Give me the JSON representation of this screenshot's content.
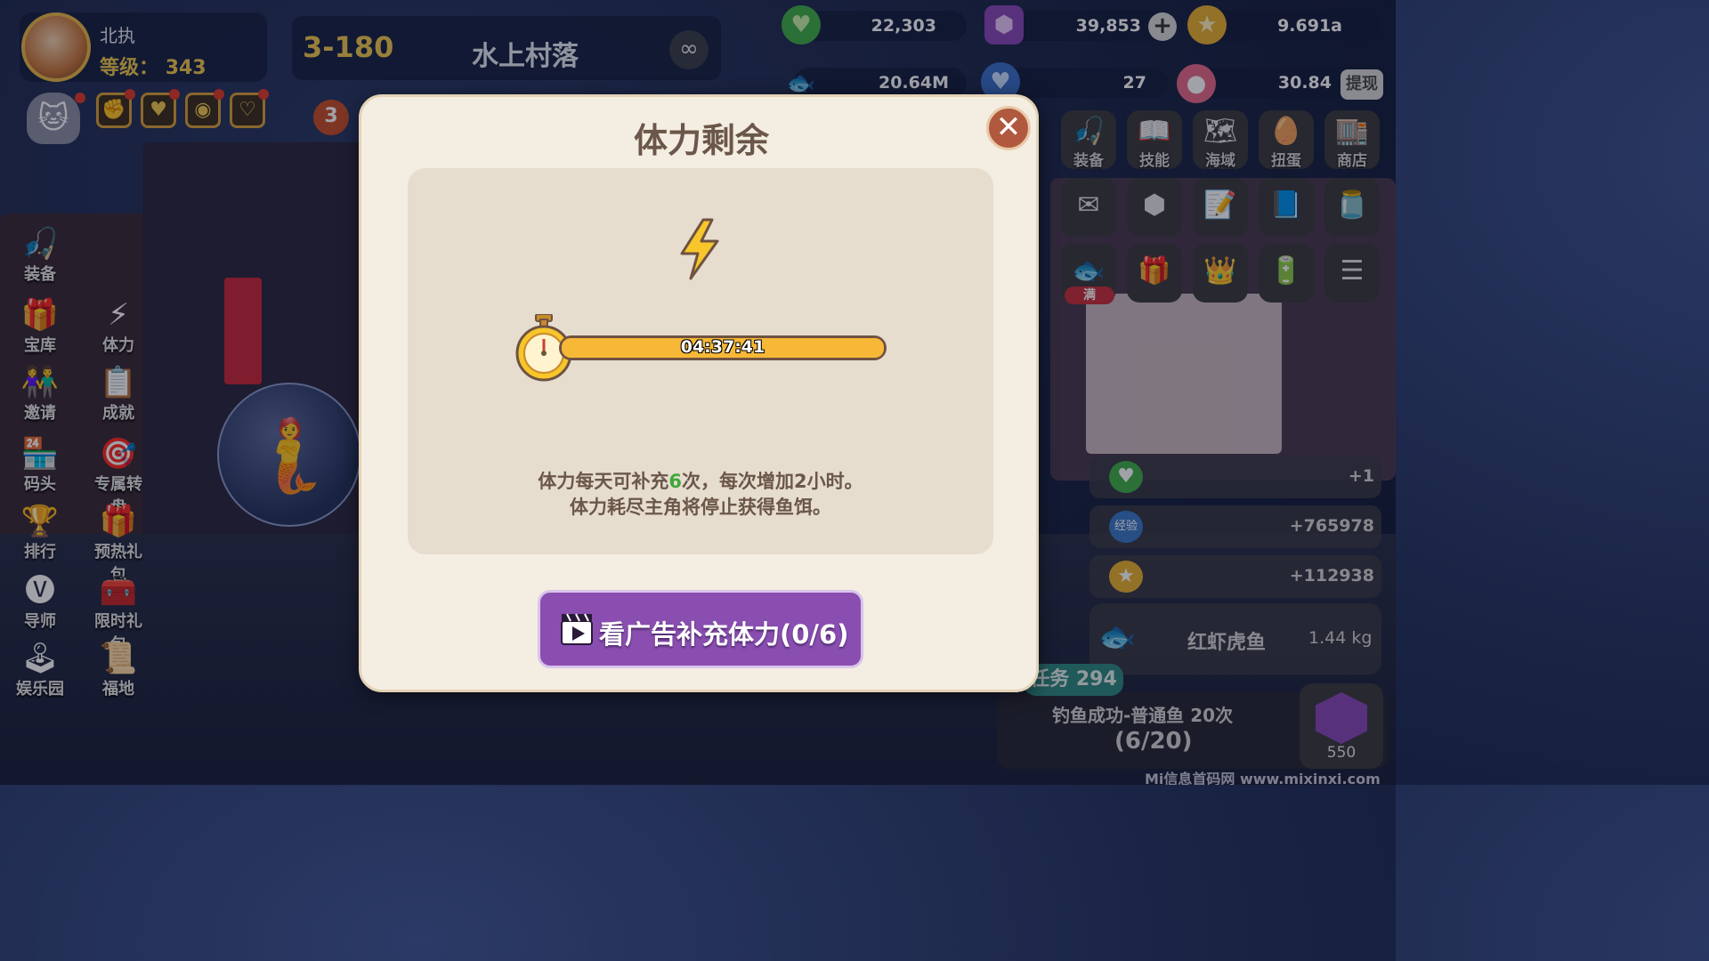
{
  "player": {
    "name": "北执",
    "level_label": "等级：",
    "level": "343"
  },
  "stage": {
    "id": "3-180",
    "name": "水上村落",
    "infinity": "∞"
  },
  "badge_count": "3",
  "currencies": {
    "hearts": "22,303",
    "gems": "39,853",
    "coins": "9.691a",
    "fish_value": "20.64M",
    "blue_hearts": "27",
    "pearl": "30.84",
    "withdraw_label": "提现",
    "plus": "+"
  },
  "left_menu": [
    {
      "label": "装备",
      "icon": "fishing-rod-icon",
      "glyph": "🎣"
    },
    {
      "label": "宝库",
      "icon": "treasure-icon",
      "glyph": "🎁"
    },
    {
      "label": "体力",
      "icon": "lightning-icon",
      "glyph": "⚡"
    },
    {
      "label": "邀请",
      "icon": "invite-icon",
      "glyph": "👫"
    },
    {
      "label": "成就",
      "icon": "clipboard-icon",
      "glyph": "📋"
    },
    {
      "label": "码头",
      "icon": "dock-icon",
      "glyph": "🏪"
    },
    {
      "label": "专属转盘",
      "icon": "wheel-icon",
      "glyph": "🎯"
    },
    {
      "label": "排行",
      "icon": "trophy-icon",
      "glyph": "🏆"
    },
    {
      "label": "预热礼包",
      "icon": "gift-icon",
      "glyph": "🎁"
    },
    {
      "label": "导师",
      "icon": "mentor-icon",
      "glyph": "🅥"
    },
    {
      "label": "限时礼包",
      "icon": "chest-icon",
      "glyph": "🧰"
    },
    {
      "label": "娱乐园",
      "icon": "joystick-icon",
      "glyph": "🕹"
    },
    {
      "label": "福地",
      "icon": "map-scroll-icon",
      "glyph": "📜"
    }
  ],
  "right_grid": {
    "row1": [
      {
        "label": "装备",
        "icon": "fishing-rod-icon",
        "glyph": "🎣"
      },
      {
        "label": "技能",
        "icon": "skill-book-icon",
        "glyph": "📖"
      },
      {
        "label": "海域",
        "icon": "sea-map-icon",
        "glyph": "🗺"
      },
      {
        "label": "扭蛋",
        "icon": "gacha-icon",
        "glyph": "🥚"
      },
      {
        "label": "商店",
        "icon": "shop-icon",
        "glyph": "🏬"
      }
    ],
    "row2_icons": [
      "mail-icon",
      "fish-badge-icon",
      "task-list-icon",
      "fish-book-icon",
      "fish-jar-icon"
    ],
    "row2_glyphs": [
      "✉",
      "⬢",
      "📝",
      "📘",
      "🫙"
    ],
    "row3_icons": [
      "fish-basket-icon",
      "gift-box-icon",
      "crown-icon",
      "battery-icon",
      "menu-icon"
    ],
    "row3_glyphs": [
      "🐟",
      "🎁",
      "👑",
      "🔋",
      "☰"
    ],
    "full_tag": "满"
  },
  "rewards": [
    {
      "icon": "heart-icon",
      "value": "+1",
      "glyph": "♥",
      "color": "#3fae4a"
    },
    {
      "icon": "exp-icon",
      "value": "+765978",
      "glyph": "经验",
      "color": "#3a7ac8"
    },
    {
      "icon": "coin-icon",
      "value": "+112938",
      "glyph": "★",
      "color": "#e8b030"
    }
  ],
  "catch": {
    "name": "红虾虎鱼",
    "weight": "1.44 kg"
  },
  "task": {
    "tag": "任务 294",
    "text": "钓鱼成功-普通鱼 20次",
    "progress": "(6/20)",
    "reward_count": "550"
  },
  "modal": {
    "title": "体力剩余",
    "close": "✕",
    "timer": "04:37:41",
    "progress_fraction": 1.0,
    "desc_line1_a": "体力每天可补充",
    "desc_line1_num": "6",
    "desc_line1_b": "次，每次增加2小时。",
    "desc_line2": "体力耗尽主角将停止获得鱼饵。",
    "ad_button": "看广告补充体力(0/6)"
  },
  "watermark": "Mi信息首码网 www.mixinxi.com",
  "colors": {
    "accent_gold": "#f0c850",
    "modal_bg": "#f4ede1",
    "modal_text": "#6b574a",
    "ad_button": "#8a4eb0",
    "progress": "#f6b836",
    "close_button": "#b0593e"
  }
}
